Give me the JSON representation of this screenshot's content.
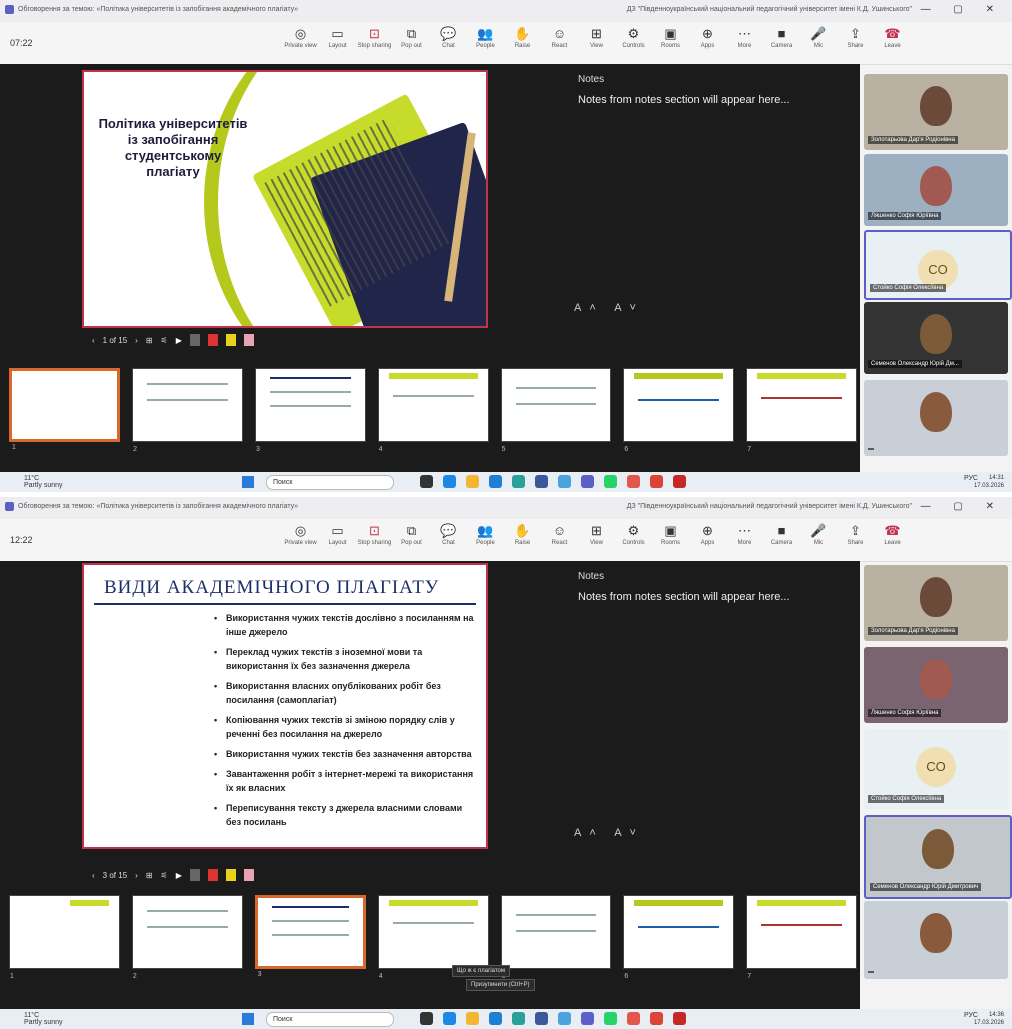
{
  "window": {
    "title": "Обговорення за темою: «Політика університетів із запобігання академічного плагіату»",
    "org": "ДЗ \"Південноукраїнський національний педагогічний університет імені К.Д. Ушинського\"",
    "controls": "— ▢ ✕"
  },
  "toolbar": {
    "items": [
      {
        "glyph": "◎",
        "label": "Private view"
      },
      {
        "glyph": "▭",
        "label": "Layout"
      },
      {
        "glyph": "⊡",
        "label": "Stop sharing"
      },
      {
        "glyph": "⧉",
        "label": "Pop out"
      },
      {
        "glyph": "💬",
        "label": "Chat"
      },
      {
        "glyph": "👥",
        "label": "People"
      },
      {
        "glyph": "✋",
        "label": "Raise"
      },
      {
        "glyph": "☺",
        "label": "React"
      },
      {
        "glyph": "⊞",
        "label": "View"
      },
      {
        "glyph": "⚙",
        "label": "Controls"
      },
      {
        "glyph": "▣",
        "label": "Rooms"
      },
      {
        "glyph": "⊕",
        "label": "Apps"
      },
      {
        "glyph": "⋯",
        "label": "More"
      },
      {
        "glyph": "■",
        "label": "Camera"
      },
      {
        "glyph": "🎤",
        "label": "Mic"
      },
      {
        "glyph": "⇪",
        "label": "Share"
      },
      {
        "glyph": "☎",
        "label": "Leave"
      }
    ]
  },
  "notes": {
    "label": "Notes",
    "text": "Notes from notes section will appear here..."
  },
  "fontbtns": "A˄ A˅",
  "shot1": {
    "timer": "07:22",
    "slide_title": "Політика університетів із запобігання студентському плагіату",
    "counter": "1 of 15",
    "thumbs": [
      "1",
      "2",
      "3",
      "4",
      "5",
      "6",
      "7"
    ],
    "participants": [
      "Золотарьова Дар'я Родіонівна",
      "Ляшенко Софія Юріївна",
      "Стойко Софія Олексіївна",
      "Семенов Олександр Юрій Дм...",
      ""
    ]
  },
  "shot2": {
    "timer": "12:22",
    "slide_title": "ВИДИ АКАДЕМІЧНОГО ПЛАГІАТУ",
    "bullets": [
      "Використання чужих текстів дослівно з посиланням на інше джерело",
      "Переклад чужих текстів з іноземної мови та використання їх без зазначення джерела",
      "Використання власних опублікованих робіт без посилання (самоплагіат)",
      "Копіювання чужих текстів зі зміною порядку слів у реченні без посилання на джерело",
      "Використання чужих текстів без зазначення авторства",
      "Завантаження робіт з інтернет-мережі та використання їх як власних",
      "Переписування тексту з джерела власними словами без посилань"
    ],
    "counter": "3 of 15",
    "thumbs": [
      "1",
      "2",
      "3",
      "4",
      "5",
      "6",
      "7"
    ],
    "tooltip1": "Що ж є плагіатом",
    "tooltip2": "Призупинити (Ctrl+P)",
    "participants": [
      "Золотарьова Дар'я Родіонівна",
      "Ляшенко Софія Юріївна",
      "Стойко Софія Олексіївна",
      "Семенов Олександр Юрій Дмитрович",
      ""
    ]
  },
  "avatar_initials": "CO",
  "taskbar": {
    "weather_temp": "11°C",
    "weather_desc": "Partly sunny",
    "search": "Поиск",
    "lang": "РУС",
    "time1": "14:31",
    "date1": "17.03.2026",
    "time2": "14:36",
    "date2": "17.03.2026"
  },
  "colors": {
    "accent": "#5b5fc7",
    "slide_border": "#c4314b",
    "lime": "#c7db2a",
    "navy": "#22254a",
    "thumb_selected": "#d9692b"
  }
}
